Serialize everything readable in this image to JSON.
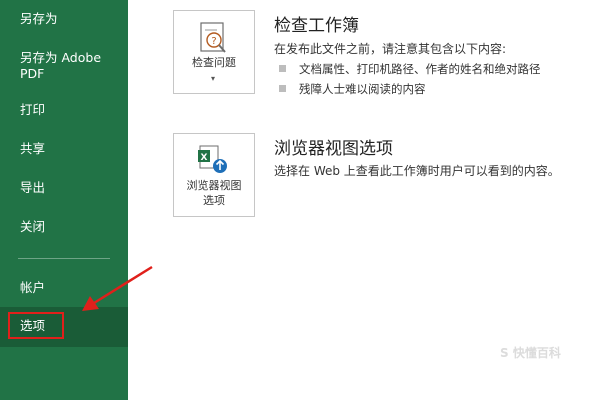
{
  "sidebar": {
    "items": [
      {
        "label": "另存为"
      },
      {
        "label": "另存为 Adobe\nPDF"
      },
      {
        "label": "打印"
      },
      {
        "label": "共享"
      },
      {
        "label": "导出"
      },
      {
        "label": "关闭"
      },
      {
        "label": "帐户"
      },
      {
        "label": "选项"
      }
    ],
    "selected_index": 7
  },
  "inspect": {
    "button_label": "检查问题",
    "title": "检查工作簿",
    "description": "在发布此文件之前，请注意其包含以下内容:",
    "bullets": [
      "文档属性、打印机路径、作者的姓名和绝对路径",
      "残障人士难以阅读的内容"
    ]
  },
  "browser": {
    "button_label_line1": "浏览器视图",
    "button_label_line2": "选项",
    "title": "浏览器视图选项",
    "description": "选择在 Web 上查看此工作簿时用户可以看到的内容。"
  },
  "watermark": "S 快懂百科",
  "colors": {
    "sidebar_bg": "#217346",
    "sidebar_selected": "#1a5c37",
    "annotation_red": "#e0201b"
  }
}
